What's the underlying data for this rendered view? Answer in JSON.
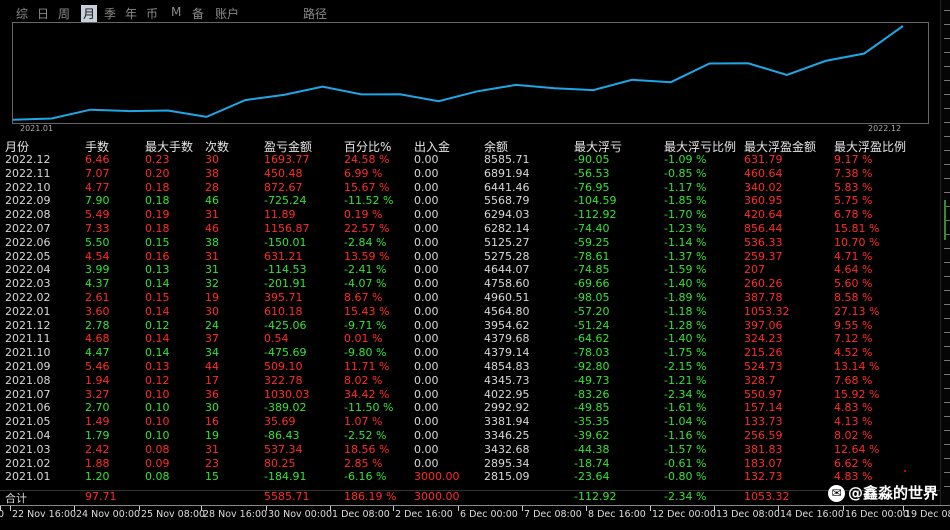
{
  "tabs": [
    "综",
    "日",
    "周",
    "月",
    "季",
    "年",
    "币",
    "M",
    "备",
    "账户",
    "路径"
  ],
  "active_tab": "月",
  "chart": {
    "start_label": "2021.01",
    "end_label": "2022.12",
    "line_color": "#1ea7e6",
    "balance_by_month": [
      2815.09,
      2895.34,
      3432.68,
      3346.25,
      3381.94,
      2992.92,
      4022.95,
      4345.73,
      4854.83,
      4379.14,
      4379.68,
      3954.62,
      4564.8,
      4960.51,
      4758.6,
      4644.07,
      5275.28,
      5125.27,
      6282.14,
      6294.03,
      5568.79,
      6441.46,
      6891.94,
      8585.71
    ]
  },
  "table": {
    "headers": [
      "月份",
      "手数",
      "最大手数",
      "次数",
      "盈亏金额",
      "百分比%",
      "出入金",
      "余额",
      "最大浮亏",
      "最大浮亏比例",
      "最大浮盈金额",
      "最大浮盈比例"
    ],
    "rows": [
      {
        "month": "2022.12",
        "lots": "6.46",
        "maxlots": "0.23",
        "count": "30",
        "pnl": "1693.77",
        "pct": "24.58 %",
        "io": "0.00",
        "bal": "8585.71",
        "maxloss": "-90.05",
        "maxlosspct": "-1.09 %",
        "maxprofit": "631.79",
        "maxprofitpct": "9.17 %",
        "c": "r"
      },
      {
        "month": "2022.11",
        "lots": "7.07",
        "maxlots": "0.20",
        "count": "38",
        "pnl": "450.48",
        "pct": "6.99 %",
        "io": "0.00",
        "bal": "6891.94",
        "maxloss": "-56.53",
        "maxlosspct": "-0.85 %",
        "maxprofit": "460.64",
        "maxprofitpct": "7.38 %",
        "c": "r"
      },
      {
        "month": "2022.10",
        "lots": "4.77",
        "maxlots": "0.18",
        "count": "28",
        "pnl": "872.67",
        "pct": "15.67 %",
        "io": "0.00",
        "bal": "6441.46",
        "maxloss": "-76.95",
        "maxlosspct": "-1.17 %",
        "maxprofit": "340.02",
        "maxprofitpct": "5.83 %",
        "c": "r"
      },
      {
        "month": "2022.09",
        "lots": "7.90",
        "maxlots": "0.18",
        "count": "46",
        "pnl": "-725.24",
        "pct": "-11.52 %",
        "io": "0.00",
        "bal": "5568.79",
        "maxloss": "-104.59",
        "maxlosspct": "-1.85 %",
        "maxprofit": "360.95",
        "maxprofitpct": "5.75 %",
        "c": "g"
      },
      {
        "month": "2022.08",
        "lots": "5.49",
        "maxlots": "0.19",
        "count": "31",
        "pnl": "11.89",
        "pct": "0.19 %",
        "io": "0.00",
        "bal": "6294.03",
        "maxloss": "-112.92",
        "maxlosspct": "-1.70 %",
        "maxprofit": "420.64",
        "maxprofitpct": "6.78 %",
        "c": "r"
      },
      {
        "month": "2022.07",
        "lots": "7.33",
        "maxlots": "0.18",
        "count": "46",
        "pnl": "1156.87",
        "pct": "22.57 %",
        "io": "0.00",
        "bal": "6282.14",
        "maxloss": "-74.40",
        "maxlosspct": "-1.23 %",
        "maxprofit": "856.44",
        "maxprofitpct": "15.81 %",
        "c": "r"
      },
      {
        "month": "2022.06",
        "lots": "5.50",
        "maxlots": "0.15",
        "count": "38",
        "pnl": "-150.01",
        "pct": "-2.84 %",
        "io": "0.00",
        "bal": "5125.27",
        "maxloss": "-59.25",
        "maxlosspct": "-1.14 %",
        "maxprofit": "536.33",
        "maxprofitpct": "10.70 %",
        "c": "g"
      },
      {
        "month": "2022.05",
        "lots": "4.54",
        "maxlots": "0.16",
        "count": "31",
        "pnl": "631.21",
        "pct": "13.59 %",
        "io": "0.00",
        "bal": "5275.28",
        "maxloss": "-78.61",
        "maxlosspct": "-1.37 %",
        "maxprofit": "259.37",
        "maxprofitpct": "4.71 %",
        "c": "r"
      },
      {
        "month": "2022.04",
        "lots": "3.99",
        "maxlots": "0.13",
        "count": "31",
        "pnl": "-114.53",
        "pct": "-2.41 %",
        "io": "0.00",
        "bal": "4644.07",
        "maxloss": "-74.85",
        "maxlosspct": "-1.59 %",
        "maxprofit": "207",
        "maxprofitpct": "4.64 %",
        "c": "g"
      },
      {
        "month": "2022.03",
        "lots": "4.37",
        "maxlots": "0.14",
        "count": "32",
        "pnl": "-201.91",
        "pct": "-4.07 %",
        "io": "0.00",
        "bal": "4758.60",
        "maxloss": "-69.66",
        "maxlosspct": "-1.40 %",
        "maxprofit": "260.26",
        "maxprofitpct": "5.60 %",
        "c": "g"
      },
      {
        "month": "2022.02",
        "lots": "2.61",
        "maxlots": "0.15",
        "count": "19",
        "pnl": "395.71",
        "pct": "8.67 %",
        "io": "0.00",
        "bal": "4960.51",
        "maxloss": "-98.05",
        "maxlosspct": "-1.89 %",
        "maxprofit": "387.78",
        "maxprofitpct": "8.58 %",
        "c": "r"
      },
      {
        "month": "2022.01",
        "lots": "3.60",
        "maxlots": "0.14",
        "count": "30",
        "pnl": "610.18",
        "pct": "15.43 %",
        "io": "0.00",
        "bal": "4564.80",
        "maxloss": "-57.20",
        "maxlosspct": "-1.18 %",
        "maxprofit": "1053.32",
        "maxprofitpct": "27.13 %",
        "c": "r"
      },
      {
        "month": "2021.12",
        "lots": "2.78",
        "maxlots": "0.12",
        "count": "24",
        "pnl": "-425.06",
        "pct": "-9.71 %",
        "io": "0.00",
        "bal": "3954.62",
        "maxloss": "-51.24",
        "maxlosspct": "-1.28 %",
        "maxprofit": "397.06",
        "maxprofitpct": "9.55 %",
        "c": "g"
      },
      {
        "month": "2021.11",
        "lots": "4.68",
        "maxlots": "0.14",
        "count": "37",
        "pnl": "0.54",
        "pct": "0.01 %",
        "io": "0.00",
        "bal": "4379.68",
        "maxloss": "-64.62",
        "maxlosspct": "-1.40 %",
        "maxprofit": "324.23",
        "maxprofitpct": "7.12 %",
        "c": "r"
      },
      {
        "month": "2021.10",
        "lots": "4.47",
        "maxlots": "0.14",
        "count": "34",
        "pnl": "-475.69",
        "pct": "-9.80 %",
        "io": "0.00",
        "bal": "4379.14",
        "maxloss": "-78.03",
        "maxlosspct": "-1.75 %",
        "maxprofit": "215.26",
        "maxprofitpct": "4.52 %",
        "c": "g"
      },
      {
        "month": "2021.09",
        "lots": "5.46",
        "maxlots": "0.13",
        "count": "44",
        "pnl": "509.10",
        "pct": "11.71 %",
        "io": "0.00",
        "bal": "4854.83",
        "maxloss": "-92.80",
        "maxlosspct": "-2.15 %",
        "maxprofit": "524.73",
        "maxprofitpct": "13.14 %",
        "c": "r"
      },
      {
        "month": "2021.08",
        "lots": "1.94",
        "maxlots": "0.12",
        "count": "17",
        "pnl": "322.78",
        "pct": "8.02 %",
        "io": "0.00",
        "bal": "4345.73",
        "maxloss": "-49.73",
        "maxlosspct": "-1.21 %",
        "maxprofit": "328.7",
        "maxprofitpct": "7.68 %",
        "c": "r"
      },
      {
        "month": "2021.07",
        "lots": "3.27",
        "maxlots": "0.10",
        "count": "36",
        "pnl": "1030.03",
        "pct": "34.42 %",
        "io": "0.00",
        "bal": "4022.95",
        "maxloss": "-83.26",
        "maxlosspct": "-2.34 %",
        "maxprofit": "550.97",
        "maxprofitpct": "15.92 %",
        "c": "r"
      },
      {
        "month": "2021.06",
        "lots": "2.70",
        "maxlots": "0.10",
        "count": "30",
        "pnl": "-389.02",
        "pct": "-11.50 %",
        "io": "0.00",
        "bal": "2992.92",
        "maxloss": "-49.85",
        "maxlosspct": "-1.61 %",
        "maxprofit": "157.14",
        "maxprofitpct": "4.83 %",
        "c": "g"
      },
      {
        "month": "2021.05",
        "lots": "1.49",
        "maxlots": "0.10",
        "count": "16",
        "pnl": "35.69",
        "pct": "1.07 %",
        "io": "0.00",
        "bal": "3381.94",
        "maxloss": "-35.35",
        "maxlosspct": "-1.04 %",
        "maxprofit": "133.73",
        "maxprofitpct": "4.13 %",
        "c": "r"
      },
      {
        "month": "2021.04",
        "lots": "1.79",
        "maxlots": "0.10",
        "count": "19",
        "pnl": "-86.43",
        "pct": "-2.52 %",
        "io": "0.00",
        "bal": "3346.25",
        "maxloss": "-39.62",
        "maxlosspct": "-1.16 %",
        "maxprofit": "256.59",
        "maxprofitpct": "8.02 %",
        "c": "g"
      },
      {
        "month": "2021.03",
        "lots": "2.42",
        "maxlots": "0.08",
        "count": "31",
        "pnl": "537.34",
        "pct": "18.56 %",
        "io": "0.00",
        "bal": "3432.68",
        "maxloss": "-44.38",
        "maxlosspct": "-1.57 %",
        "maxprofit": "381.83",
        "maxprofitpct": "12.64 %",
        "c": "r"
      },
      {
        "month": "2021.02",
        "lots": "1.88",
        "maxlots": "0.09",
        "count": "23",
        "pnl": "80.25",
        "pct": "2.85 %",
        "io": "0.00",
        "bal": "2895.34",
        "maxloss": "-18.74",
        "maxlosspct": "-0.61 %",
        "maxprofit": "183.07",
        "maxprofitpct": "6.62 %",
        "c": "r"
      },
      {
        "month": "2021.01",
        "lots": "1.20",
        "maxlots": "0.08",
        "count": "15",
        "pnl": "-184.91",
        "pct": "-6.16 %",
        "io": "3000.00",
        "bal": "2815.09",
        "maxloss": "-23.64",
        "maxlosspct": "-0.80 %",
        "maxprofit": "132.73",
        "maxprofitpct": "4.83 %",
        "c": "g"
      }
    ],
    "total": {
      "label": "合计",
      "lots": "97.71",
      "pnl": "5585.71",
      "pct": "186.19 %",
      "io": "3000.00",
      "maxloss": "-112.92",
      "maxlosspct": "-2.34 %",
      "maxprofit": "1053.32"
    }
  },
  "time_axis": [
    "0",
    "22 Nov 16:00",
    "24 Nov 00:00",
    "25 Nov 08:00",
    "28 Nov 16:00",
    "30 Nov 00:00",
    "1 Dec 08:00",
    "2 Dec 16:00",
    "6 Dec 00:00",
    "7 Dec 08:00",
    "8 Dec 16:00",
    "12 Dec 00:00",
    "13 Dec 08:00",
    "14 Dec 16:00",
    "16 Dec 00:00",
    "19 Dec 08"
  ],
  "watermark": "@鑫淼的世界"
}
